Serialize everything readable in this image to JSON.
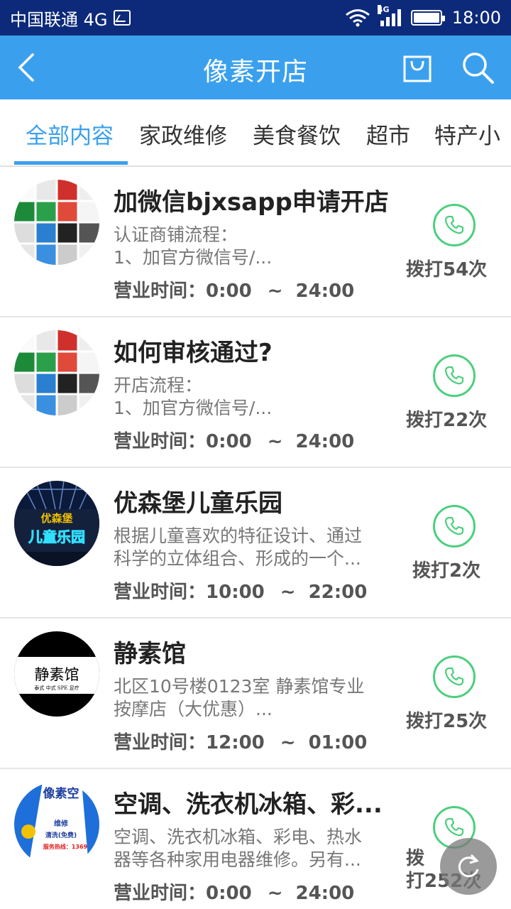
{
  "status_bar": {
    "carrier": "中国联通 4G",
    "network_small": "4G",
    "time": "18:00"
  },
  "header": {
    "title": "像素开店",
    "back_icon": "chevron-left-icon",
    "bag_icon": "shopping-bag-icon",
    "search_icon": "search-icon",
    "background_color": "#3aa0ed"
  },
  "tabs": [
    {
      "label": "全部内容",
      "active": true
    },
    {
      "label": "家政维修",
      "active": false
    },
    {
      "label": "美食餐饮",
      "active": false
    },
    {
      "label": "超市",
      "active": false
    },
    {
      "label": "特产小",
      "active": false
    }
  ],
  "hours_label": "营业时间：",
  "hours_separator": "~",
  "shops": [
    {
      "title": "加微信bjxsapp申请开店",
      "desc_line1": "认证商铺流程：",
      "desc_line2": "1、加官方微信号/...",
      "open": "0:00",
      "close": "24:00",
      "calls": "拨打54次"
    },
    {
      "title": "如何审核通过?",
      "desc_line1": "开店流程：",
      "desc_line2": "1、加官方微信号/...",
      "open": "0:00",
      "close": "24:00",
      "calls": "拨打22次"
    },
    {
      "title": "优森堡儿童乐园",
      "desc_line1": "根据儿童喜欢的特征设计、通过",
      "desc_line2": "科学的立体组合、形成的一个...",
      "open": "10:00",
      "close": "22:00",
      "calls": "拨打2次",
      "logo_text_top": "优森堡",
      "logo_text_bottom": "儿童乐园"
    },
    {
      "title": "静素馆",
      "desc_line1": "北区10号楼0123室 静素馆专业",
      "desc_line2": "按摩店（大优惠）...",
      "open": "12:00",
      "close": "01:00",
      "calls": "拨打25次",
      "logo_text": "静素馆",
      "logo_subtext": "泰式   中式   SPE   足疗"
    },
    {
      "title": "空调、洗衣机冰箱、彩...",
      "desc_line1": "空调、洗衣机冰箱、彩电、热水",
      "desc_line2": "器等各种家用电器维修。另有...",
      "open": "0:00",
      "close": "24:00",
      "calls_line1": "拨",
      "calls_line2": "打252次",
      "logo_text": "像素空",
      "logo_line2": "维修",
      "logo_line3": "清洗(免费)",
      "logo_line4": "服务热线：1369"
    }
  ],
  "colors": {
    "accent": "#3aa0ed",
    "call_green": "#4ccf7e",
    "status_bar": "#0d2a7a"
  },
  "fab_icon": "refresh-icon"
}
